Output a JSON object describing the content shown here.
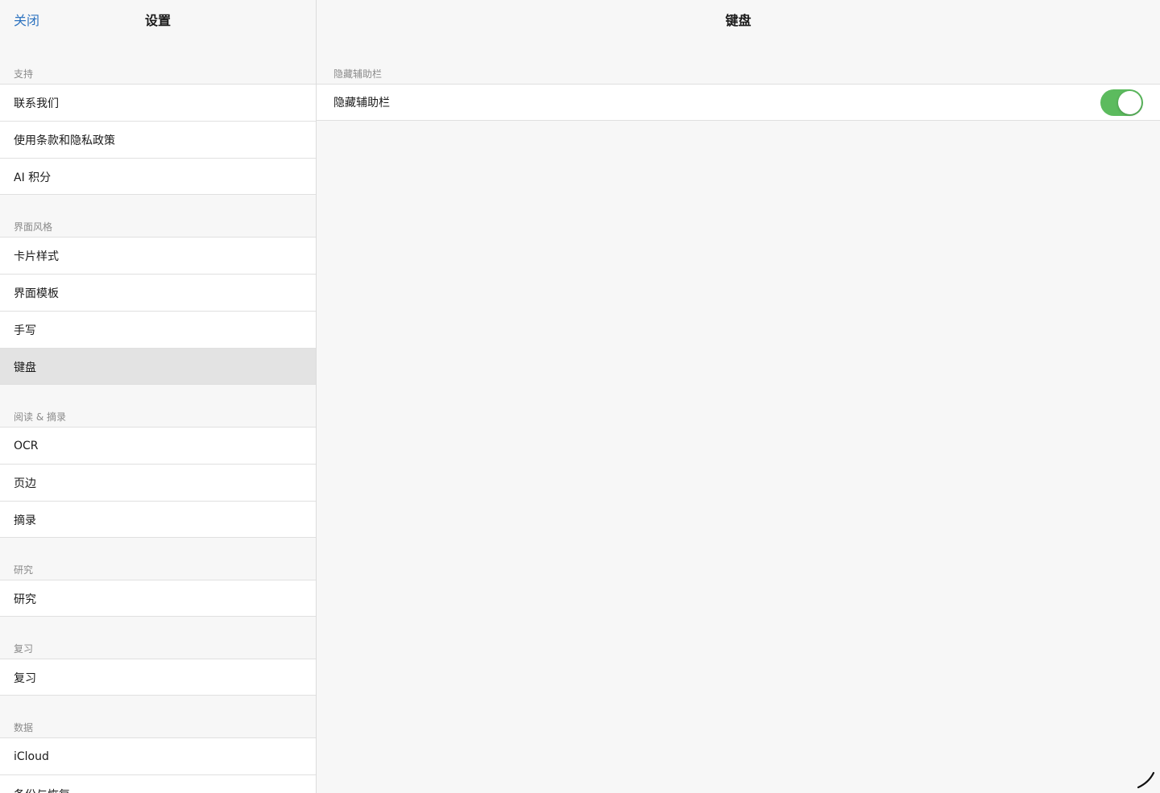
{
  "sidebar": {
    "close_label": "关闭",
    "title": "设置",
    "groups": [
      {
        "title": "支持",
        "items": [
          {
            "label": "联系我们"
          },
          {
            "label": "使用条款和隐私政策"
          },
          {
            "label": "AI 积分"
          }
        ]
      },
      {
        "title": "界面风格",
        "items": [
          {
            "label": "卡片样式"
          },
          {
            "label": "界面模板"
          },
          {
            "label": "手写"
          },
          {
            "label": "键盘",
            "selected": true
          }
        ]
      },
      {
        "title": "阅读 & 摘录",
        "items": [
          {
            "label": "OCR"
          },
          {
            "label": "页边"
          },
          {
            "label": "摘录"
          }
        ]
      },
      {
        "title": "研究",
        "items": [
          {
            "label": "研究"
          }
        ]
      },
      {
        "title": "复习",
        "items": [
          {
            "label": "复习"
          }
        ]
      },
      {
        "title": "数据",
        "items": [
          {
            "label": "iCloud"
          },
          {
            "label": "备份与恢复"
          }
        ]
      }
    ]
  },
  "detail": {
    "title": "键盘",
    "group_title": "隐藏辅助栏",
    "row_label": "隐藏辅助栏",
    "toggle_on": true
  },
  "colors": {
    "accent": "#2f74c0",
    "toggle_on": "#5cbb5e",
    "selected_row": "#e3e3e3"
  }
}
